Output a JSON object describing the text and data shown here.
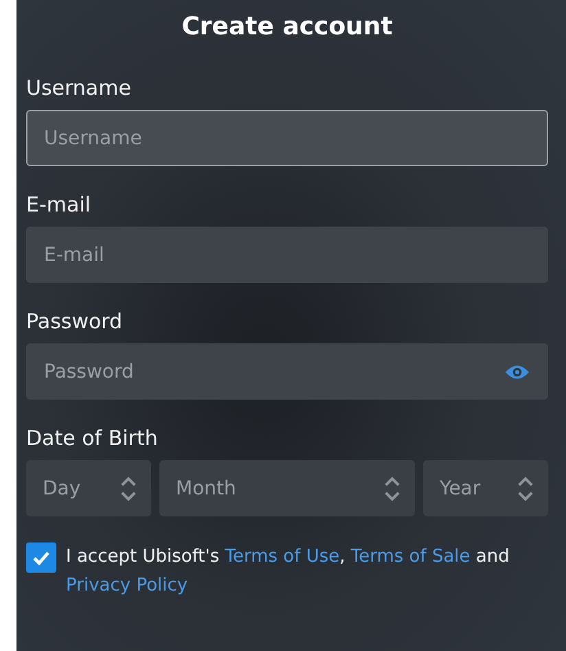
{
  "title": "Create account",
  "fields": [
    {
      "kind": "text",
      "label": "Username",
      "placeholder": "Username",
      "focused": true
    },
    {
      "kind": "text",
      "label": "E-mail",
      "placeholder": "E-mail",
      "focused": false
    },
    {
      "kind": "password",
      "label": "Password",
      "placeholder": "Password",
      "focused": false
    }
  ],
  "date_of_birth": {
    "label": "Date of Birth",
    "selects": [
      {
        "placeholder": "Day"
      },
      {
        "placeholder": "Month"
      },
      {
        "placeholder": "Year"
      }
    ]
  },
  "consent": {
    "checked": true,
    "parts": [
      {
        "kind": "text",
        "text": "I accept Ubisoft's "
      },
      {
        "kind": "link",
        "text": "Terms of Use"
      },
      {
        "kind": "text",
        "text": ", "
      },
      {
        "kind": "link",
        "text": "Terms of Sale"
      },
      {
        "kind": "text",
        "text": " and "
      },
      {
        "kind": "link",
        "text": "Privacy Policy"
      }
    ]
  }
}
